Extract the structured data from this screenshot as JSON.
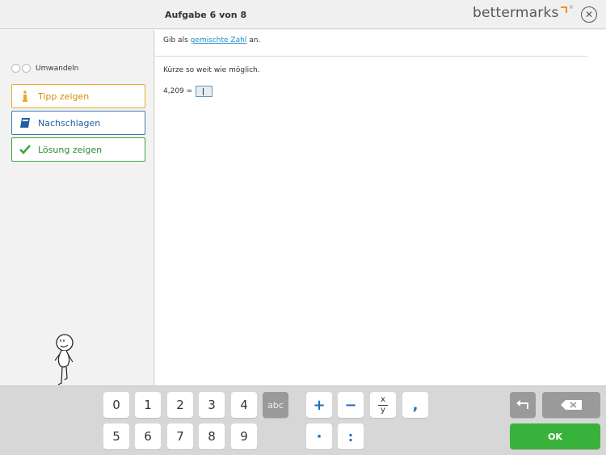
{
  "header": {
    "title": "Aufgabe 6 von 8",
    "logo_text": "bettermarks",
    "logo_reg": "®",
    "close_symbol": "✕"
  },
  "sidebar": {
    "toggle_label": "Umwandeln",
    "buttons": [
      {
        "label": "Tipp zeigen",
        "icon": "info-icon",
        "color": "#e8a82a"
      },
      {
        "label": "Nachschlagen",
        "icon": "book-icon",
        "color": "#1f5f9e"
      },
      {
        "label": "Lösung zeigen",
        "icon": "check-icon",
        "color": "#3aa53a"
      }
    ]
  },
  "main": {
    "instruction_prefix": "Gib als",
    "instruction_link": "gemischte Zahl",
    "instruction_suffix": "an.",
    "sub_instruction": "Kürze so weit wie möglich.",
    "equation_left": "4,209 ="
  },
  "keyboard": {
    "digits_row1": [
      "0",
      "1",
      "2",
      "3",
      "4"
    ],
    "digits_row2": [
      "5",
      "6",
      "7",
      "8",
      "9"
    ],
    "abc_label": "abc",
    "plus": "+",
    "minus": "−",
    "frac_num": "x",
    "frac_den": "y",
    "comma": ",",
    "dot": "·",
    "colon": ":",
    "ok_label": "OK"
  },
  "colors": {
    "accent_orange": "#f39200",
    "link_blue": "#1a8fd0",
    "ok_green": "#39b23b"
  }
}
